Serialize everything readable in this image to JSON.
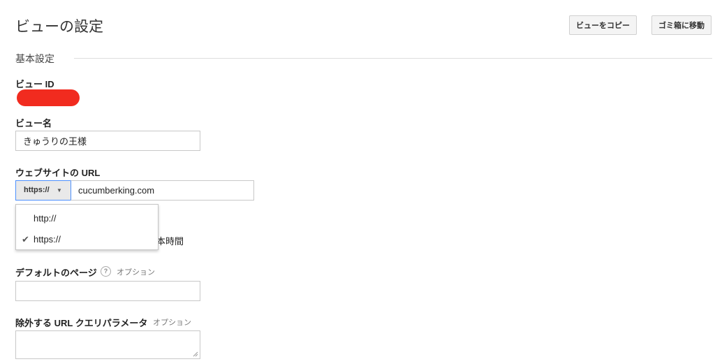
{
  "page": {
    "title": "ビューの設定"
  },
  "header": {
    "copy_view_label": "ビューをコピー",
    "trash_label": "ゴミ箱に移動"
  },
  "section": {
    "title": "基本設定"
  },
  "view_id": {
    "label": "ビュー ID"
  },
  "view_name": {
    "label": "ビュー名",
    "value": "きゅうりの王様"
  },
  "website_url": {
    "label": "ウェブサイトの URL",
    "protocol_selected": "https://",
    "value": "cucumberking.com",
    "protocol_options": [
      {
        "label": "http://",
        "selected": false
      },
      {
        "label": "https://",
        "selected": true
      }
    ]
  },
  "timezone": {
    "partial_text": "本時間"
  },
  "default_page": {
    "label": "デフォルトのページ",
    "help": "?",
    "optional": "オプション",
    "value": ""
  },
  "exclude_params": {
    "label": "除外する URL クエリパラメータ",
    "optional": "オプション",
    "value": ""
  },
  "colors": {
    "accent": "#4d90fe",
    "redaction": "#f12b1f"
  },
  "icons": {
    "caret": "caret-down-icon",
    "check": "check-icon",
    "help": "help-icon",
    "resize": "resize-handle-icon"
  }
}
